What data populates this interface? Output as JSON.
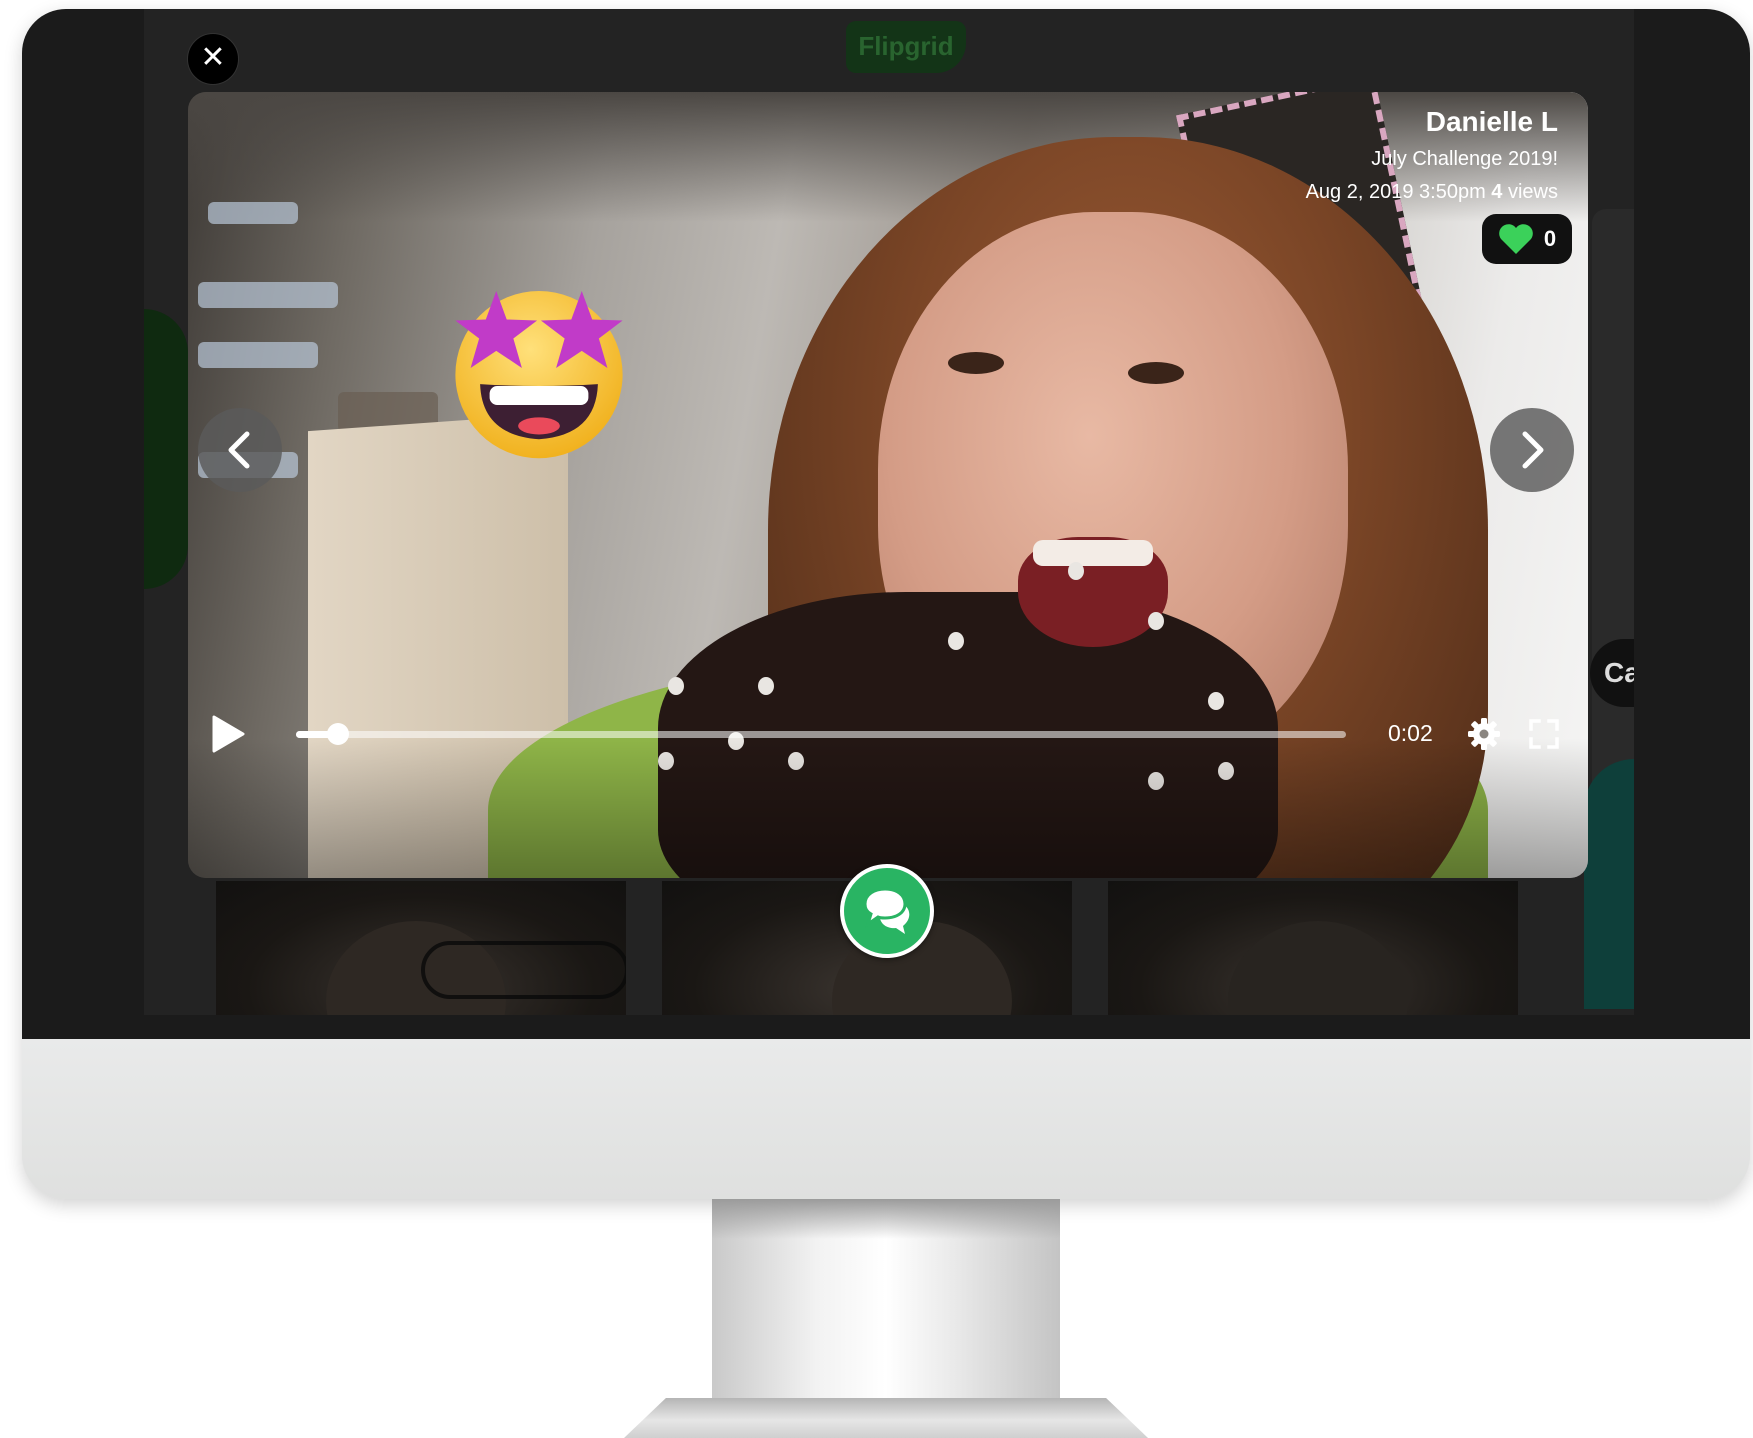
{
  "app": {
    "logo_text": "Flipgrid"
  },
  "video": {
    "author": "Danielle L",
    "topic": "July Challenge 2019!",
    "date_time": "Aug 2, 2019 3:50pm",
    "views_count": "4",
    "views_label": "views",
    "likes": "0",
    "current_time": "0:02",
    "progress_fraction": 0.04,
    "sticker": "star-struck-emoji"
  },
  "background": {
    "partial_label": "Ca"
  },
  "icons": {
    "close": "close-icon",
    "previous": "chevron-left-icon",
    "next": "chevron-right-icon",
    "like": "heart-icon",
    "play": "play-icon",
    "settings": "gear-icon",
    "fullscreen": "fullscreen-icon",
    "reply": "chat-bubbles-icon"
  },
  "colors": {
    "brand_green": "#29b463",
    "heart_green": "#3bd15a",
    "sticker_purple": "#c13bc8",
    "bezel": "#1b1b1b"
  }
}
